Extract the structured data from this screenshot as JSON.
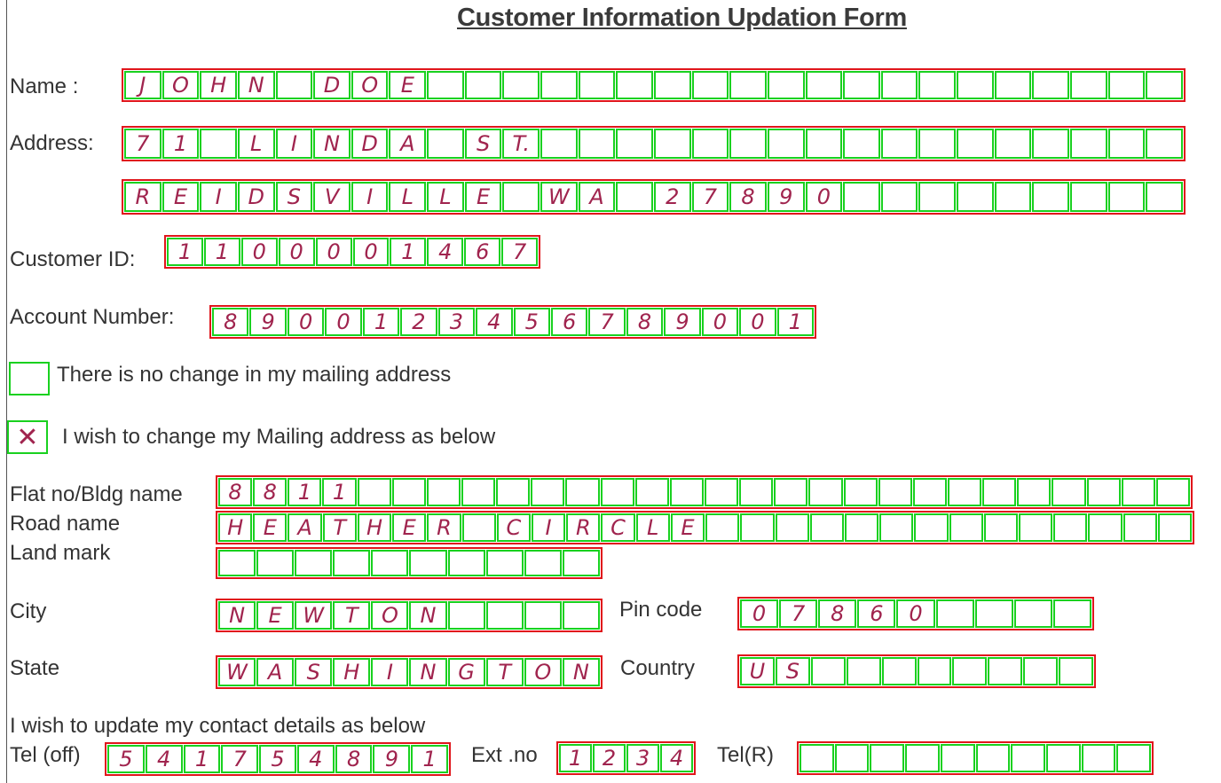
{
  "title": "Customer Information  Updation Form",
  "labels": {
    "name": "Name :",
    "address": "Address:",
    "customer_id": "Customer ID:",
    "account_number": "Account Number:",
    "no_change": "There is no change in my mailing address",
    "wish_change": "I wish to change my Mailing address as below",
    "flat": "Flat no/Bldg name",
    "road": "Road name",
    "landmark": "Land mark",
    "city": "City",
    "pin": "Pin code",
    "state": "State",
    "country": "Country",
    "contact": "I wish to update my contact details as below",
    "tel_off": "Tel (off)",
    "ext": "Ext .no",
    "tel_r": "Tel(R)"
  },
  "checkboxes": {
    "no_change_checked": false,
    "wish_change_checked": true,
    "check_mark": "✕"
  },
  "fields": {
    "name": {
      "cells": 28,
      "chars": [
        "J",
        "O",
        "H",
        "N",
        "",
        "D",
        "O",
        "E"
      ]
    },
    "address1": {
      "cells": 28,
      "chars": [
        "7",
        "1",
        "",
        "L",
        "I",
        "N",
        "D",
        "A",
        "",
        "S",
        "T."
      ]
    },
    "address2": {
      "cells": 28,
      "chars": [
        "R",
        "E",
        "I",
        "D",
        "S",
        "V",
        "I",
        "L",
        "L",
        "E",
        "",
        "W",
        "A",
        "",
        "2",
        "7",
        "8",
        "9",
        "0"
      ]
    },
    "customer_id": {
      "cells": 10,
      "chars": [
        "1",
        "1",
        "0",
        "0",
        "0",
        "0",
        "1",
        "4",
        "6",
        "7"
      ]
    },
    "account_number": {
      "cells": 16,
      "chars": [
        "8",
        "9",
        "0",
        "0",
        "1",
        "2",
        "3",
        "4",
        "5",
        "6",
        "7",
        "8",
        "9",
        "0",
        "0",
        "1"
      ]
    },
    "flat": {
      "cells": 28,
      "chars": [
        "8",
        "8",
        "1",
        "1"
      ]
    },
    "road": {
      "cells": 28,
      "chars": [
        "H",
        "E",
        "A",
        "T",
        "H",
        "E",
        "R",
        "",
        "C",
        "I",
        "R",
        "C",
        "L",
        "E"
      ]
    },
    "landmark": {
      "cells": 10,
      "chars": []
    },
    "city": {
      "cells": 10,
      "chars": [
        "N",
        "E",
        "W",
        "T",
        "O",
        "N"
      ]
    },
    "pin": {
      "cells": 9,
      "chars": [
        "0",
        "7",
        "8",
        "6",
        "0"
      ]
    },
    "state": {
      "cells": 10,
      "chars": [
        "W",
        "A",
        "S",
        "H",
        "I",
        "N",
        "G",
        "T",
        "O",
        "N"
      ]
    },
    "country": {
      "cells": 10,
      "chars": [
        "U",
        "S"
      ]
    },
    "tel_off": {
      "cells": 9,
      "chars": [
        "5",
        "4",
        "1",
        "7",
        "5",
        "4",
        "8",
        "9",
        "1"
      ]
    },
    "ext": {
      "cells": 4,
      "chars": [
        "1",
        "2",
        "3",
        "4"
      ]
    },
    "tel_r": {
      "cells": 10,
      "chars": []
    }
  },
  "colors": {
    "outer_box": "#e0161b",
    "cell_box": "#19d11f",
    "handwriting": "#a0244e"
  }
}
